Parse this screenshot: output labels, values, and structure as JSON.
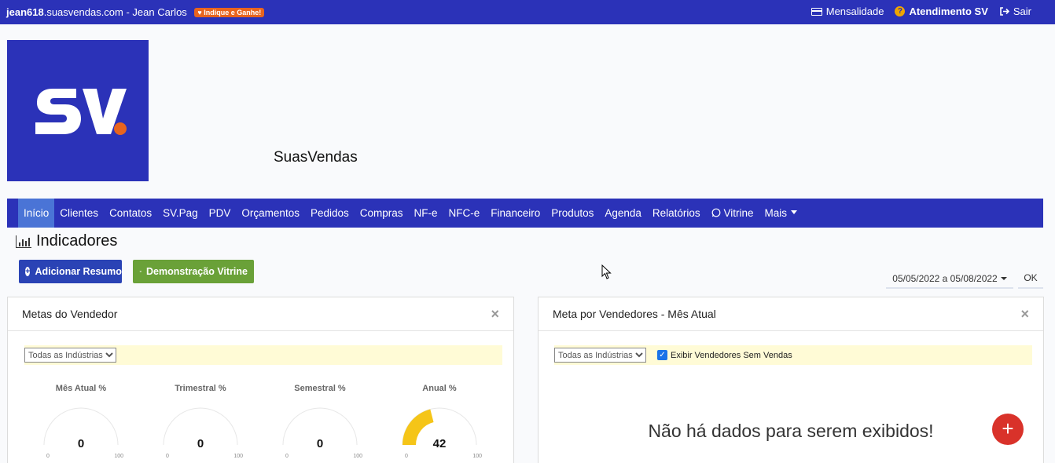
{
  "topbar": {
    "account": "jean618",
    "domain": ".suasvendas.com",
    "user": " - Jean Carlos",
    "badge": "Indique e Ganhe!",
    "mensalidade": "Mensalidade",
    "atendimento": "Atendimento SV",
    "sair": "Sair"
  },
  "brand": {
    "logo_text": "SV",
    "name": "SuasVendas"
  },
  "nav": {
    "items": [
      "Início",
      "Clientes",
      "Contatos",
      "SV.Pag",
      "PDV",
      "Orçamentos",
      "Pedidos",
      "Compras",
      "NF-e",
      "NFC-e",
      "Financeiro",
      "Produtos",
      "Agenda",
      "Relatórios",
      "Vitrine",
      "Mais"
    ]
  },
  "page": {
    "title": "Indicadores",
    "btn_add": "Adicionar Resumo",
    "btn_demo": "Demonstração Vitrine",
    "date_range": "05/05/2022 a 05/08/2022",
    "ok": "OK"
  },
  "panel_left": {
    "title": "Metas do Vendedor",
    "close": "×",
    "filter": "Todas as Indústrias",
    "gauges": [
      {
        "title": "Mês Atual %",
        "value": "0",
        "min": "0",
        "max": "100",
        "fill": 0
      },
      {
        "title": "Trimestral %",
        "value": "0",
        "min": "0",
        "max": "100",
        "fill": 0
      },
      {
        "title": "Semestral %",
        "value": "0",
        "min": "0",
        "max": "100",
        "fill": 0
      },
      {
        "title": "Anual %",
        "value": "42",
        "min": "0",
        "max": "100",
        "fill": 0.42
      }
    ]
  },
  "panel_right": {
    "title": "Meta por Vendedores - Mês Atual",
    "close": "×",
    "filter": "Todas as Indústrias",
    "checkbox_label": "Exibir Vendedores Sem Vendas",
    "empty": "Não há dados para serem exibidos!",
    "fab": "+"
  },
  "colors": {
    "primary": "#2b32b8",
    "accent_orange": "#e8641e",
    "gauge_fill": "#f5c518",
    "danger": "#d9322a",
    "success": "#6aa138"
  }
}
